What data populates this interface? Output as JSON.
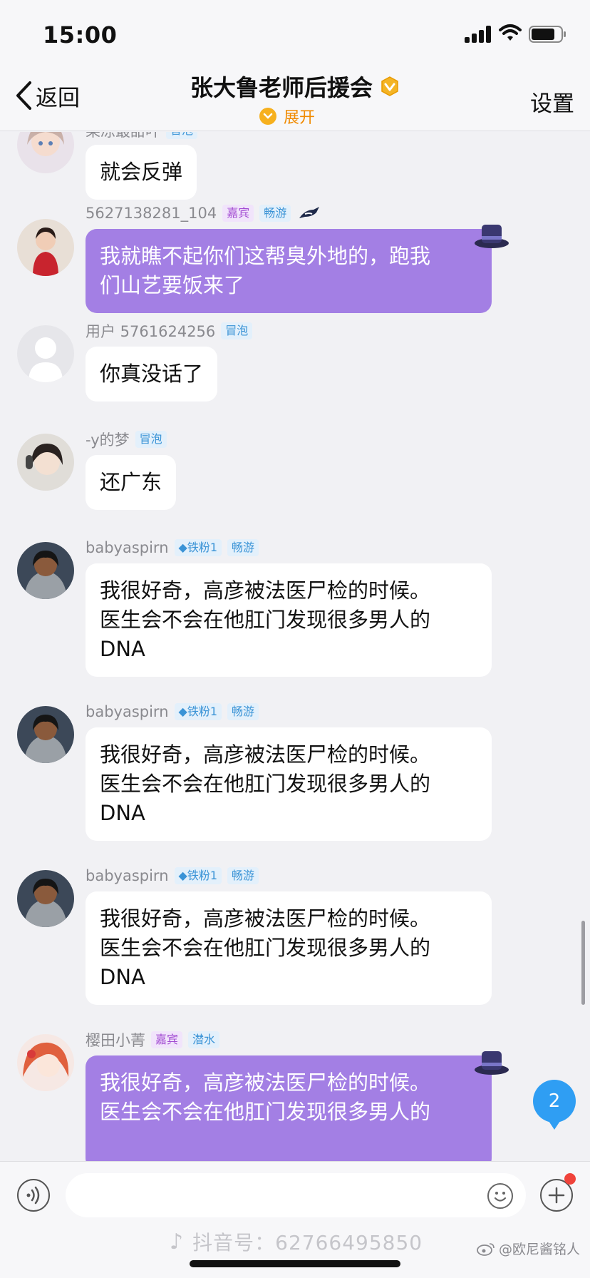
{
  "status_bar": {
    "time": "15:00"
  },
  "nav": {
    "back_label": "返回",
    "title": "张大鲁老师后援会",
    "expand_label": "展开",
    "settings_label": "设置"
  },
  "messages": [
    {
      "username": "果冻最甜吖",
      "tags": [
        {
          "text": "冒泡",
          "color": "blue"
        }
      ],
      "text_lines": [
        "就会反弹"
      ],
      "bubble": "white"
    },
    {
      "username": "5627138281_104",
      "tags": [
        {
          "text": "嘉宾",
          "color": "purple"
        },
        {
          "text": "畅游",
          "color": "blue"
        }
      ],
      "text_lines": [
        "我就瞧不起你们这帮臭外地的，跑我",
        "们山艺要饭来了"
      ],
      "bubble": "purple"
    },
    {
      "username": "用户 5761624256",
      "tags": [
        {
          "text": "冒泡",
          "color": "blue"
        }
      ],
      "text_lines": [
        "你真没话了"
      ],
      "bubble": "white"
    },
    {
      "username": "-y的梦",
      "tags": [
        {
          "text": "冒泡",
          "color": "blue"
        }
      ],
      "text_lines": [
        "还广东"
      ],
      "bubble": "white"
    },
    {
      "username": "babyaspirn",
      "tags": [
        {
          "text": "◆铁粉1",
          "color": "blue"
        },
        {
          "text": "畅游",
          "color": "blue"
        }
      ],
      "text_lines": [
        "我很好奇，高彦被法医尸检的时候。",
        "医生会不会在他肛门发现很多男人的",
        "DNA"
      ],
      "bubble": "white"
    },
    {
      "username": "babyaspirn",
      "tags": [
        {
          "text": "◆铁粉1",
          "color": "blue"
        },
        {
          "text": "畅游",
          "color": "blue"
        }
      ],
      "text_lines": [
        "我很好奇，高彦被法医尸检的时候。",
        "医生会不会在他肛门发现很多男人的",
        "DNA"
      ],
      "bubble": "white"
    },
    {
      "username": "babyaspirn",
      "tags": [
        {
          "text": "◆铁粉1",
          "color": "blue"
        },
        {
          "text": "畅游",
          "color": "blue"
        }
      ],
      "text_lines": [
        "我很好奇，高彦被法医尸检的时候。",
        "医生会不会在他肛门发现很多男人的",
        "DNA"
      ],
      "bubble": "white"
    },
    {
      "username": "樱田小菁",
      "tags": [
        {
          "text": "嘉宾",
          "color": "purple"
        },
        {
          "text": "潜水",
          "color": "blue"
        }
      ],
      "text_lines": [
        "我很好奇，高彦被法医尸检的时候。",
        "医生会不会在他肛门发现很多男人的"
      ],
      "bubble": "purple"
    }
  ],
  "unread_count": "2",
  "input": {
    "placeholder": ""
  },
  "watermark": {
    "douyin": "抖音号：62766495850",
    "weibo": "@欧尼酱铭人"
  },
  "colors": {
    "purple_bubble": "#a37fe4",
    "tag_blue": "#3a93d6",
    "tag_purple": "#a24bd2",
    "badge_blue": "#2f9ef3"
  }
}
